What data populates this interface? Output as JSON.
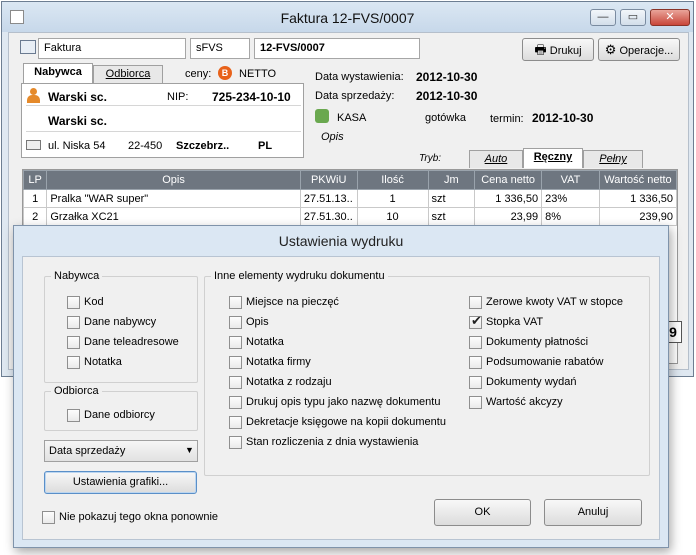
{
  "window": {
    "title": "Faktura 12-FVS/0007",
    "minimize": "—",
    "maximize": "▭",
    "close": "✕"
  },
  "header": {
    "doc_type": "Faktura",
    "series": "sFVS",
    "number": "12-FVS/0007",
    "print_label": "Drukuj",
    "operations_label": "Operacje..."
  },
  "buyer": {
    "tab_buyer": "Nabywca",
    "tab_recipient": "Odbiorca",
    "prices_label": "ceny:",
    "prices_badge": "B",
    "prices_value": "NETTO",
    "name1": "Warski sc.",
    "nip_label": "NIP:",
    "nip": "725-234-10-10",
    "name2": "Warski sc.",
    "street": "ul. Niska 54",
    "postcode": "22-450",
    "city": "Szczebrz..",
    "country": "PL"
  },
  "dates": {
    "issue_label": "Data wystawienia:",
    "issue": "2012-10-30",
    "sale_label": "Data sprzedaży:",
    "sale": "2012-10-30",
    "payment_method": "KASA",
    "payment_form": "gotówka",
    "term_label": "termin:",
    "term": "2012-10-30",
    "notes_label": "Opis"
  },
  "mode": {
    "label": "Tryb:",
    "tabs": [
      "Auto",
      "Ręczny",
      "Pełny"
    ]
  },
  "items": {
    "columns": [
      "LP",
      "Opis",
      "PKWiU",
      "Ilość",
      "Jm",
      "Cena netto",
      "VAT",
      "Wartość netto"
    ],
    "rows": [
      [
        "1",
        "Pralka \"WAR super\"",
        "27.51.13..",
        "1",
        "szt",
        "1 336,50",
        "23%",
        "1 336,50"
      ],
      [
        "2",
        "Grzałka XC21",
        "27.51.30..",
        "10",
        "szt",
        "23,99",
        "8%",
        "239,90"
      ]
    ],
    "peek_digit": "9"
  },
  "dialog": {
    "title": "Ustawienia wydruku",
    "buyer_group": "Nabywca",
    "buyer_options": [
      "Kod",
      "Dane nabywcy",
      "Dane teleadresowe",
      "Notatka"
    ],
    "recipient_group": "Odbiorca",
    "recipient_options": [
      "Dane odbiorcy"
    ],
    "date_select": "Data sprzedaży",
    "graphics_button": "Ustawienia grafiki...",
    "other_group": "Inne elementy wydruku dokumentu",
    "other_left": [
      "Miejsce na pieczęć",
      "Opis",
      "Notatka",
      "Notatka firmy",
      "Notatka z rodzaju",
      "Drukuj opis typu jako nazwę dokumentu",
      "Dekretacje księgowe na kopii dokumentu",
      "Stan rozliczenia z dnia wystawienia"
    ],
    "other_right": [
      "Zerowe kwoty VAT w stopce",
      "Stopka VAT",
      "Dokumenty płatności",
      "Podsumowanie rabatów",
      "Dokumenty wydań",
      "Wartość akcyzy"
    ],
    "other_right_checked": [
      false,
      true,
      false,
      false,
      false,
      false
    ],
    "dont_show": "Nie pokazuj tego okna ponownie",
    "ok": "OK",
    "cancel": "Anuluj"
  }
}
